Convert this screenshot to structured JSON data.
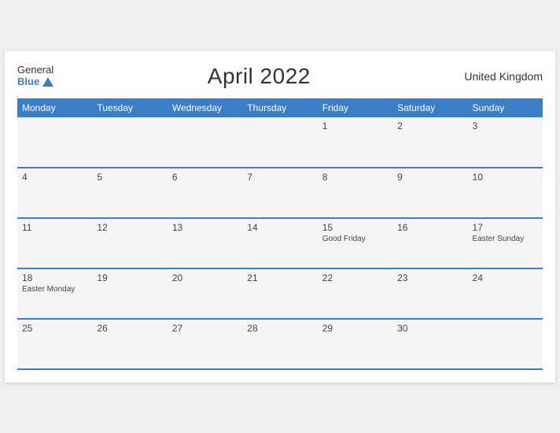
{
  "header": {
    "logo_general": "General",
    "logo_blue": "Blue",
    "title": "April 2022",
    "country": "United Kingdom"
  },
  "days_of_week": [
    "Monday",
    "Tuesday",
    "Wednesday",
    "Thursday",
    "Friday",
    "Saturday",
    "Sunday"
  ],
  "weeks": [
    [
      {
        "date": "",
        "holiday": ""
      },
      {
        "date": "",
        "holiday": ""
      },
      {
        "date": "",
        "holiday": ""
      },
      {
        "date": "",
        "holiday": ""
      },
      {
        "date": "1",
        "holiday": ""
      },
      {
        "date": "2",
        "holiday": ""
      },
      {
        "date": "3",
        "holiday": ""
      }
    ],
    [
      {
        "date": "4",
        "holiday": ""
      },
      {
        "date": "5",
        "holiday": ""
      },
      {
        "date": "6",
        "holiday": ""
      },
      {
        "date": "7",
        "holiday": ""
      },
      {
        "date": "8",
        "holiday": ""
      },
      {
        "date": "9",
        "holiday": ""
      },
      {
        "date": "10",
        "holiday": ""
      }
    ],
    [
      {
        "date": "11",
        "holiday": ""
      },
      {
        "date": "12",
        "holiday": ""
      },
      {
        "date": "13",
        "holiday": ""
      },
      {
        "date": "14",
        "holiday": ""
      },
      {
        "date": "15",
        "holiday": "Good Friday"
      },
      {
        "date": "16",
        "holiday": ""
      },
      {
        "date": "17",
        "holiday": "Easter Sunday"
      }
    ],
    [
      {
        "date": "18",
        "holiday": "Easter Monday"
      },
      {
        "date": "19",
        "holiday": ""
      },
      {
        "date": "20",
        "holiday": ""
      },
      {
        "date": "21",
        "holiday": ""
      },
      {
        "date": "22",
        "holiday": ""
      },
      {
        "date": "23",
        "holiday": ""
      },
      {
        "date": "24",
        "holiday": ""
      }
    ],
    [
      {
        "date": "25",
        "holiday": ""
      },
      {
        "date": "26",
        "holiday": ""
      },
      {
        "date": "27",
        "holiday": ""
      },
      {
        "date": "28",
        "holiday": ""
      },
      {
        "date": "29",
        "holiday": ""
      },
      {
        "date": "30",
        "holiday": ""
      },
      {
        "date": "",
        "holiday": ""
      }
    ]
  ]
}
